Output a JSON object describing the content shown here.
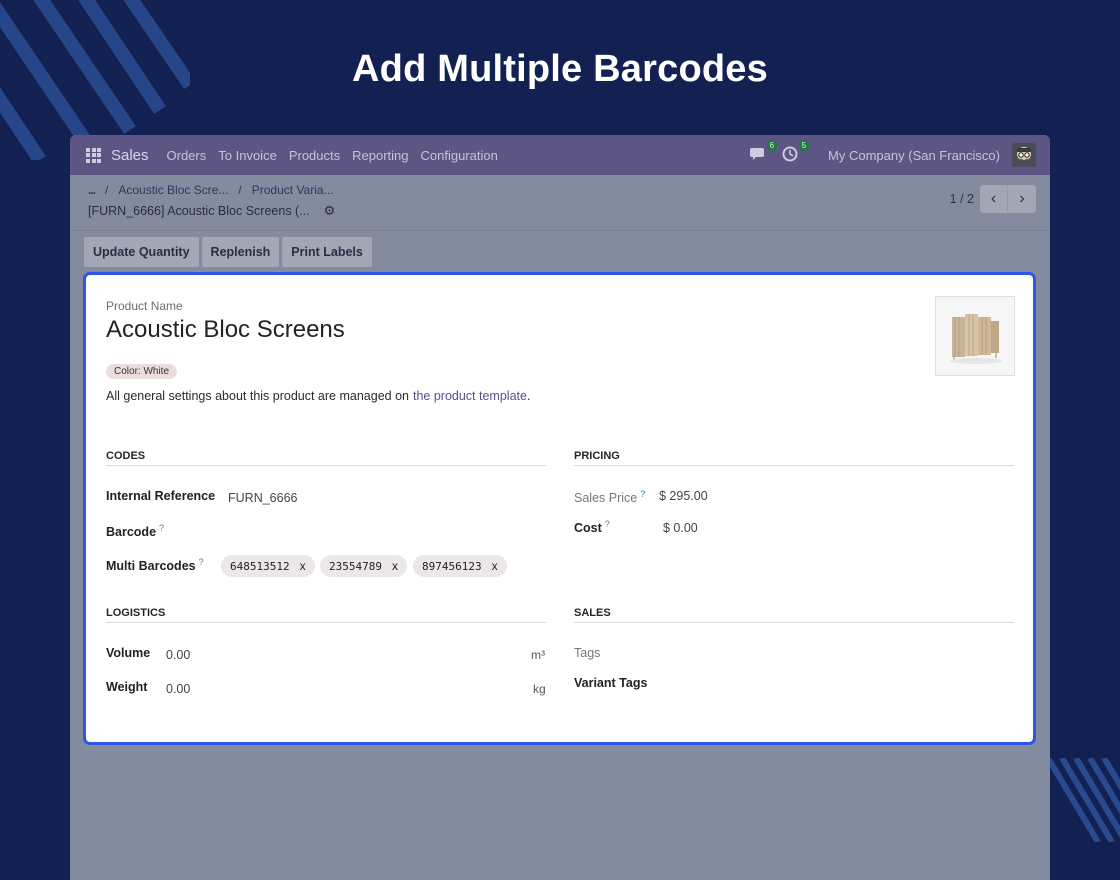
{
  "hero": {
    "title": "Add Multiple Barcodes"
  },
  "navbar": {
    "app_name": "Sales",
    "menu": [
      "Orders",
      "To Invoice",
      "Products",
      "Reporting",
      "Configuration"
    ],
    "messages_count": "6",
    "activities_count": "5",
    "company": "My Company (San Francisco)"
  },
  "control_panel": {
    "breadcrumb": [
      "...",
      "Acoustic Bloc Scre...",
      "Product Varia..."
    ],
    "record_title": "[FURN_6666] Acoustic Bloc Screens (...",
    "pager": "1 / 2"
  },
  "actions": [
    "Update Quantity",
    "Replenish",
    "Print Labels"
  ],
  "form": {
    "product_name_label": "Product Name",
    "product_name": "Acoustic Bloc Screens",
    "color_attribute": "Color: White",
    "template_note": "All general settings about this product are managed on",
    "template_link": "the product template",
    "template_note_end": ".",
    "codes": {
      "heading": "CODES",
      "internal_reference_label": "Internal Reference",
      "internal_reference": "FURN_6666",
      "barcode_label": "Barcode",
      "multi_barcodes_label": "Multi Barcodes",
      "multi_barcodes": [
        "648513512",
        "23554789",
        "897456123"
      ],
      "remove_glyph": "x"
    },
    "pricing": {
      "heading": "PRICING",
      "sales_price_label": "Sales Price",
      "sales_price": "$ 295.00",
      "cost_label": "Cost",
      "cost": "$ 0.00"
    },
    "logistics": {
      "heading": "LOGISTICS",
      "volume_label": "Volume",
      "volume": "0.00",
      "volume_unit": "m³",
      "weight_label": "Weight",
      "weight": "0.00",
      "weight_unit": "kg"
    },
    "sales": {
      "heading": "SALES",
      "tags_label": "Tags",
      "variant_tags_label": "Variant Tags"
    },
    "help_mark": "?"
  },
  "colors": {
    "page_bg": "#132152",
    "navbar_bg": "#5d5685",
    "highlight_border": "#2f56e6"
  },
  "icons": [
    "apps-grid-icon",
    "chat-icon",
    "activity-clock-icon",
    "avatar-icon",
    "gear-icon",
    "chevron-left-icon",
    "chevron-right-icon"
  ]
}
